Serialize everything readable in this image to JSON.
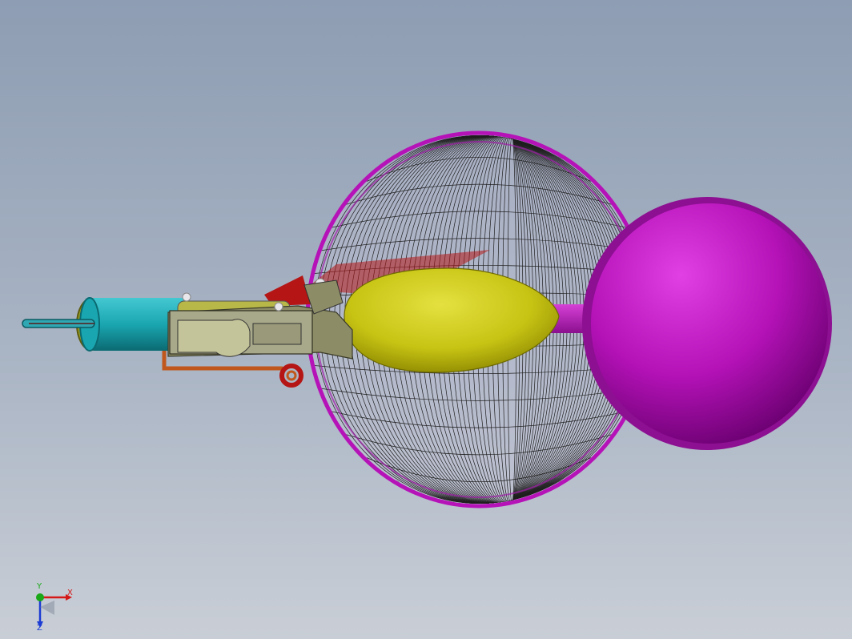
{
  "viewport": {
    "colors": {
      "bg_top": "#8e9db3",
      "bg_bottom": "#c9ced6",
      "sphere_magenta": "#b512b8",
      "wire_mesh": "#1f1f1f",
      "bulb_yellow": "#c8c414",
      "barrel_teal": "#1aa6b0",
      "fin_red": "#b51515",
      "pipe_orange": "#c0581e"
    }
  },
  "model": {
    "parts": [
      "transparent-wire-sphere",
      "solid-magenta-sphere",
      "yellow-bulb",
      "teal-cylinder",
      "clamp-assembly",
      "red-fin",
      "orange-pipe"
    ]
  },
  "triad": {
    "x_label": "X",
    "y_label": "Y",
    "z_label": "Z",
    "x_color": "#d41818",
    "y_color": "#18a818",
    "z_color": "#1c3cd4"
  }
}
